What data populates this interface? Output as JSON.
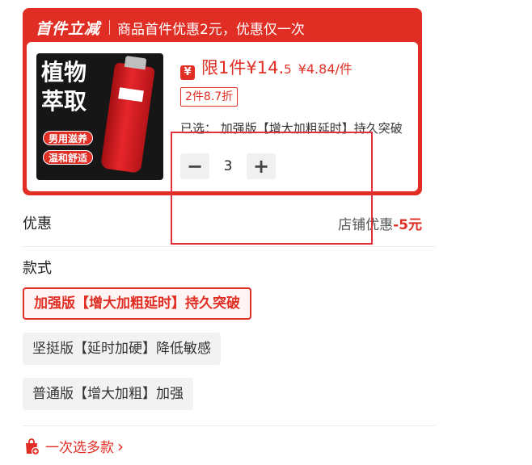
{
  "promo": {
    "tag": "首件立减",
    "description": "商品首件优惠2元，优惠仅一次"
  },
  "product": {
    "image_text": {
      "line1": "植物",
      "line2": "萃取",
      "badge1": "男用滋养",
      "badge2": "温和舒适"
    },
    "yen_badge": "¥",
    "limit_label": "限1件¥",
    "price_int": "14.",
    "price_dec": "5",
    "unit_price": "¥4.84/件",
    "discount_tag": "2件8.7折",
    "selected": "已选：  加强版【增大加粗延时】持久突破",
    "quantity": "3",
    "minus_label": "−",
    "plus_label": "+"
  },
  "discount": {
    "label": "优惠",
    "shop_text": "店铺优惠",
    "shop_value": "-5元"
  },
  "styles": {
    "label": "款式",
    "options": [
      "加强版【增大加粗延时】持久突破",
      "坚挺版【延时加硬】降低敏感",
      "普通版【增大加粗】加强"
    ],
    "selected_index": 0
  },
  "multi_select": {
    "label": "一次选多款",
    "chevron": "›"
  },
  "colors": {
    "accent": "#e02e24",
    "highlight_box": "#e0303a"
  }
}
